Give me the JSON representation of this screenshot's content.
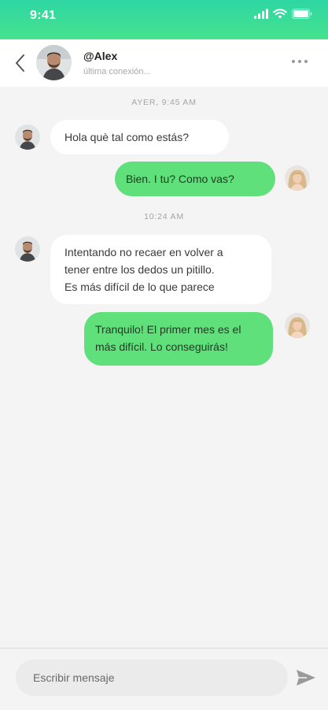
{
  "status_bar": {
    "time": "9:41",
    "icons": [
      "signal-icon",
      "wifi-icon",
      "battery-icon"
    ]
  },
  "header": {
    "back_icon": "chevron-left-icon",
    "contact_name": "@Alex",
    "last_seen": "última conexión...",
    "more_icon": "more-horizontal-icon"
  },
  "conversation": {
    "groups": [
      {
        "timestamp": "AYER, 9:45 AM",
        "messages": [
          {
            "direction": "in",
            "lines": [
              "Hola què tal como estás?"
            ]
          },
          {
            "direction": "out",
            "lines": [
              "Bien. I tu? Como vas?"
            ]
          }
        ]
      },
      {
        "timestamp": "10:24 AM",
        "messages": [
          {
            "direction": "in",
            "lines": [
              "Intentando no recaer en volver a",
              "tener entre los dedos un pitillo.",
              "Es más difícil de lo que parece"
            ]
          },
          {
            "direction": "out",
            "lines": [
              "Tranquilo! El primer mes es el",
              "más difícil. Lo conseguirás!"
            ]
          }
        ]
      }
    ]
  },
  "composer": {
    "placeholder": "Escribir mensaje",
    "send_icon": "send-icon"
  },
  "colors": {
    "status_gradient_top": "#2ed6a3",
    "status_gradient_bottom": "#46e28f",
    "outgoing_bubble": "#5fe07a",
    "incoming_bubble": "#ffffff",
    "background": "#f4f4f4"
  }
}
